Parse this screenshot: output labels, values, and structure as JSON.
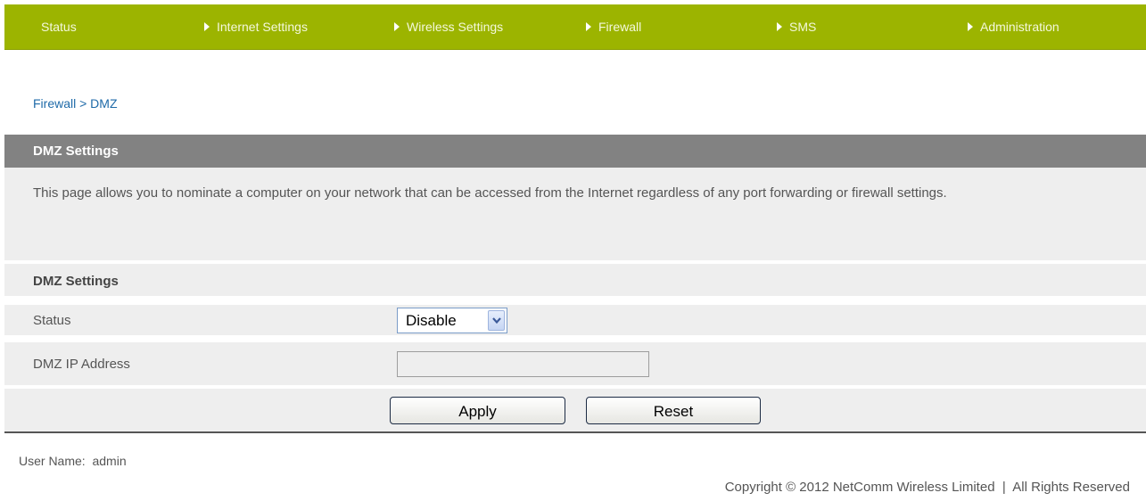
{
  "nav": {
    "items": [
      {
        "label": "Status"
      },
      {
        "label": "Internet Settings"
      },
      {
        "label": "Wireless Settings"
      },
      {
        "label": "Firewall"
      },
      {
        "label": "SMS"
      },
      {
        "label": "Administration"
      }
    ]
  },
  "breadcrumb": "Firewall > DMZ",
  "section_title": "DMZ Settings",
  "description": "This page allows you to nominate a computer on your network that can be accessed from the Internet regardless of any port forwarding or firewall settings.",
  "form": {
    "subheader": "DMZ Settings",
    "status_label": "Status",
    "status_value": "Disable",
    "ip_label": "DMZ IP Address",
    "ip_value": ""
  },
  "buttons": {
    "apply": "Apply",
    "reset": "Reset"
  },
  "footer": {
    "user_label": "User Name:",
    "user_value": "admin",
    "copyright": "Copyright © 2012 NetComm Wireless Limited  |  All Rights Reserved"
  },
  "colors": {
    "nav_bg": "#9cb400",
    "header_bg": "#828282",
    "link": "#1e6aa8"
  },
  "icons": [
    "nav-arrow-icon",
    "dropdown-arrow-icon"
  ]
}
